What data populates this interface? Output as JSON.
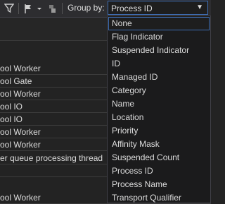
{
  "toolbar": {
    "group_by_label": "Group by:",
    "group_by_value": "Process ID",
    "icons": [
      "filter-icon",
      "flag-icon",
      "dropdown-arrow-icon",
      "threads-icon"
    ]
  },
  "threads": [
    "ool Worker",
    "ool Gate",
    "ool Worker",
    "ool IO",
    "ool IO",
    "ool Worker",
    "ool Worker",
    "er queue processing thread",
    "",
    "ool Worker"
  ],
  "dropdown": {
    "options": [
      "None",
      "Flag Indicator",
      "Suspended Indicator",
      "ID",
      "Managed ID",
      "Category",
      "Name",
      "Location",
      "Priority",
      "Affinity Mask",
      "Suspended Count",
      "Process ID",
      "Process Name",
      "Transport Qualifier"
    ],
    "selected": "None"
  },
  "colors": {
    "accent": "#3e6db2",
    "background": "#232323",
    "text": "#dcdcdc"
  }
}
